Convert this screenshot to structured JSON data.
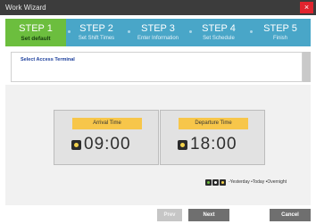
{
  "window": {
    "title": "Work Wizard",
    "close_glyph": "×"
  },
  "steps": [
    {
      "num": "STEP 1",
      "label": "Set default",
      "active": true
    },
    {
      "num": "STEP 2",
      "label": "Set Shift Times",
      "active": false
    },
    {
      "num": "STEP 3",
      "label": "Enter Information",
      "active": false
    },
    {
      "num": "STEP 4",
      "label": "Set Schedule",
      "active": false
    },
    {
      "num": "STEP 5",
      "label": "Finish",
      "active": false
    }
  ],
  "info": {
    "select_access_terminal": "Select Access Terminal"
  },
  "arrival": {
    "label": "Arrival Time",
    "time": "09:00",
    "icon": "sun-icon"
  },
  "departure": {
    "label": "Departure Time",
    "time": "18:00",
    "icon": "sun-icon"
  },
  "legend": {
    "text": "-Yesterday •Today •Overnight",
    "icon_colors": [
      "#6cbe3e",
      "#ffffff",
      "#f3d24c"
    ]
  },
  "buttons": {
    "prev": "Prev",
    "next": "Next",
    "cancel": "Cancel"
  },
  "colors": {
    "active_step": "#6cbe3e",
    "step_bar": "#49a6c8",
    "time_label": "#f7c64a",
    "close": "#e0242e"
  }
}
